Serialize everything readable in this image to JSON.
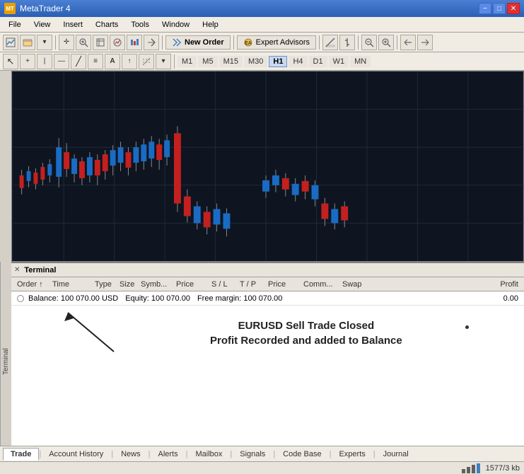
{
  "app": {
    "title": "MetaTrader 4",
    "icon_label": "MT4"
  },
  "title_bar": {
    "text": "MetaTrader 4",
    "minimize": "−",
    "maximize": "□",
    "close": "✕"
  },
  "menu": {
    "items": [
      "File",
      "View",
      "Insert",
      "Charts",
      "Tools",
      "Window",
      "Help"
    ]
  },
  "toolbar1": {
    "new_order": "New Order",
    "expert_advisors": "Expert Advisors"
  },
  "timeframes": {
    "items": [
      "M1",
      "M5",
      "M15",
      "M30",
      "H1",
      "H4",
      "D1",
      "W1",
      "MN"
    ],
    "active": "H1"
  },
  "terminal": {
    "label": "Terminal"
  },
  "table": {
    "headers": [
      "Order",
      "/",
      "Time",
      "Type",
      "Size",
      "Symb...",
      "Price",
      "S / L",
      "T / P",
      "Price",
      "Comm...",
      "Swap",
      "Profit"
    ],
    "row": {
      "balance_label": "Balance: 100 070.00 USD",
      "equity_label": "Equity: 100 070.00",
      "free_margin_label": "Free margin: 100 070.00",
      "profit_value": "0.00"
    }
  },
  "annotation": {
    "line1": "EURUSD Sell Trade Closed",
    "line2": "Profit Recorded and added to Balance"
  },
  "tabs": {
    "items": [
      "Trade",
      "Account History",
      "News",
      "Alerts",
      "Mailbox",
      "Signals",
      "Code Base",
      "Experts",
      "Journal"
    ],
    "active": "Trade"
  },
  "status_bar": {
    "text": "1577/3 kb"
  },
  "chart": {
    "bg_color": "#0e1520",
    "grid_color": "#1e2a3a",
    "bullish_color": "#1a6bc4",
    "bearish_color": "#c42020"
  }
}
